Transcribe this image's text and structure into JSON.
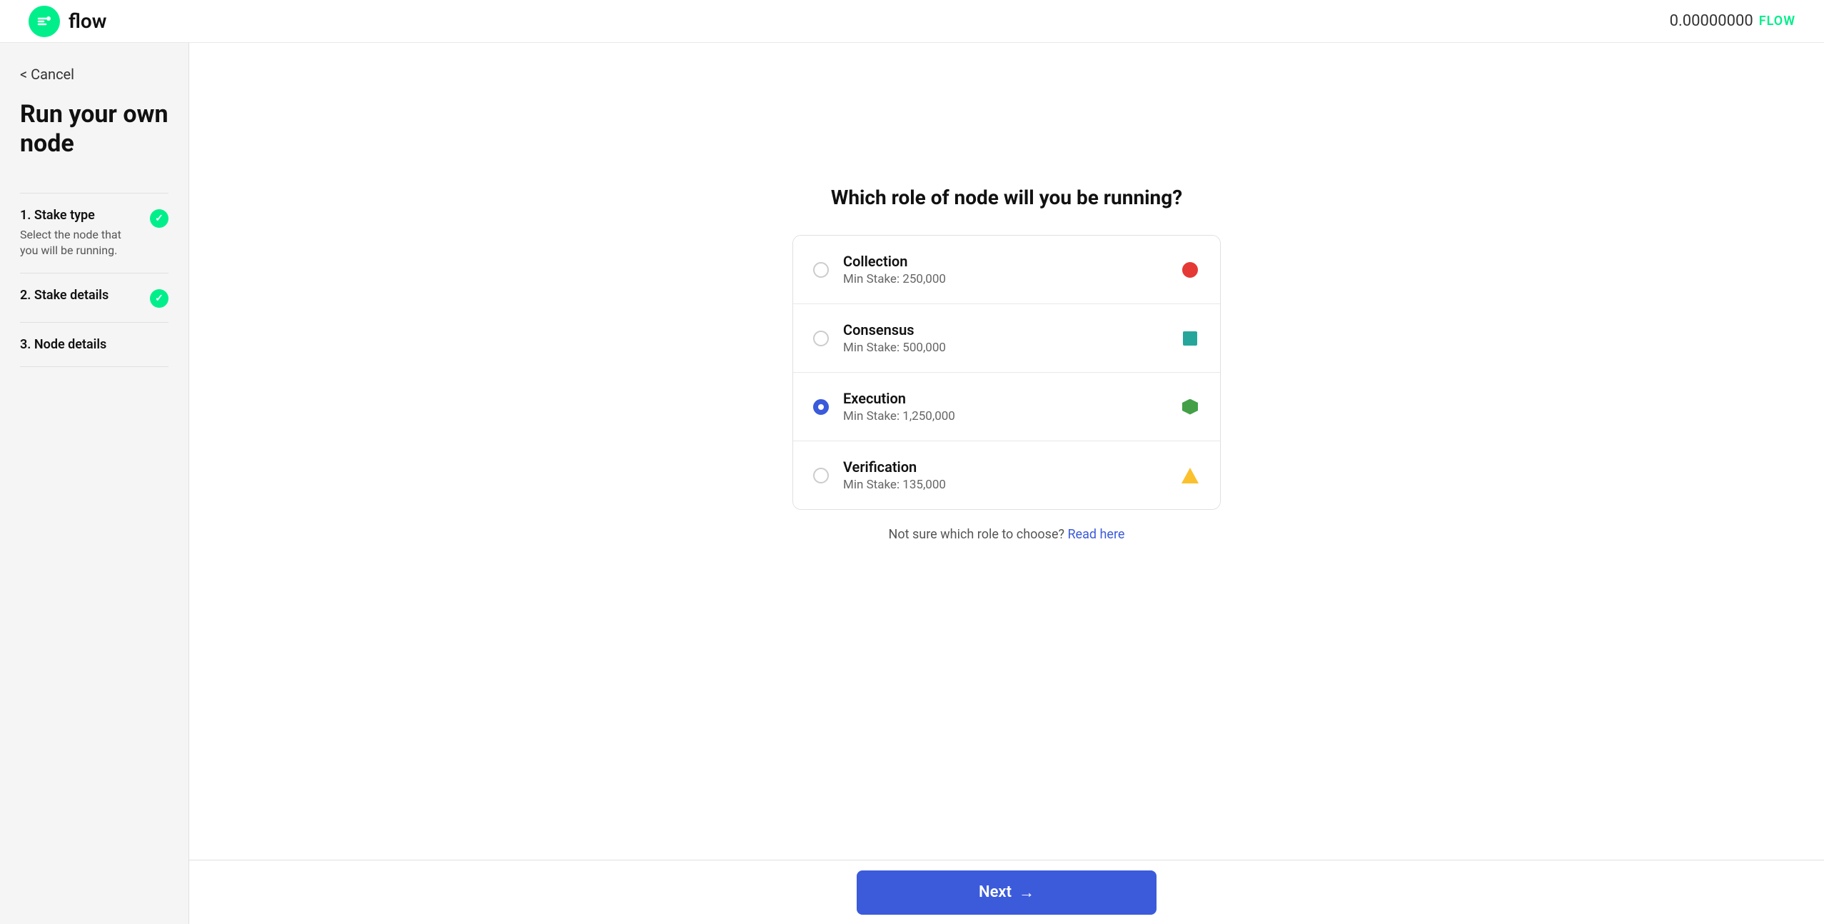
{
  "header": {
    "logo_text": "flow",
    "balance": {
      "amount": "0.00000000",
      "currency": "FLOW"
    }
  },
  "sidebar": {
    "cancel_label": "< Cancel",
    "page_title": "Run your own node",
    "steps": [
      {
        "number": "1.",
        "label": "Stake type",
        "description": "Select the node that you will be running.",
        "completed": true
      },
      {
        "number": "2.",
        "label": "Stake details",
        "description": "",
        "completed": true
      },
      {
        "number": "3.",
        "label": "Node details",
        "description": "",
        "completed": false
      }
    ]
  },
  "main": {
    "question": "Which role of node will you be running?",
    "node_options": [
      {
        "id": "collection",
        "name": "Collection",
        "min_stake": "Min Stake: 250,000",
        "shape": "circle-red",
        "selected": false
      },
      {
        "id": "consensus",
        "name": "Consensus",
        "min_stake": "Min Stake: 500,000",
        "shape": "square-teal",
        "selected": false
      },
      {
        "id": "execution",
        "name": "Execution",
        "min_stake": "Min Stake: 1,250,000",
        "shape": "hex-green",
        "selected": true
      },
      {
        "id": "verification",
        "name": "Verification",
        "min_stake": "Min Stake: 135,000",
        "shape": "triangle-yellow",
        "selected": false
      }
    ],
    "hint_text": "Not sure which role to choose?",
    "hint_link": "Read here"
  },
  "footer": {
    "next_button_label": "Next",
    "next_arrow": "→"
  }
}
